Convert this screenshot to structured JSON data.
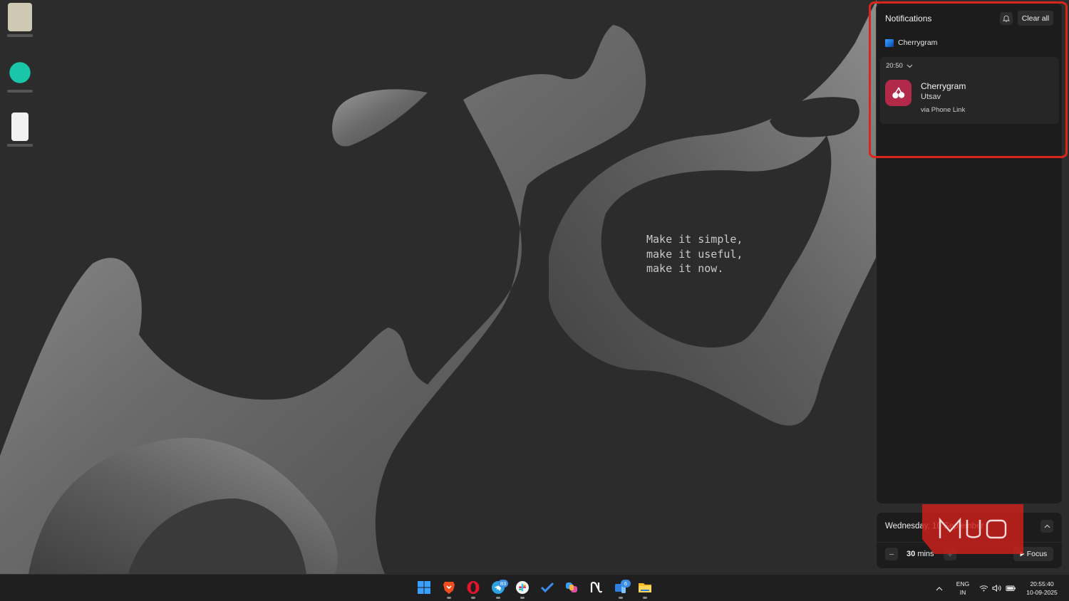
{
  "wallpaper": {
    "quote_lines": [
      "Make it simple,",
      "make it useful,",
      "make it now."
    ]
  },
  "notifications": {
    "title": "Notifications",
    "dnd_icon": "do-not-disturb-icon",
    "clear_all_label": "Clear all",
    "app_group": "Cherrygram",
    "item": {
      "time": "20:50",
      "app": "Cherrygram",
      "sender": "Utsav",
      "source": "via Phone Link"
    }
  },
  "calendar": {
    "date": "Wednesday, 10 September",
    "focus_value": "30",
    "focus_unit": "mins",
    "focus_label": "Focus"
  },
  "taskbar": {
    "apps": [
      {
        "name": "start",
        "icon": "windows-icon"
      },
      {
        "name": "brave",
        "icon": "brave-icon"
      },
      {
        "name": "opera",
        "icon": "opera-icon"
      },
      {
        "name": "telegram",
        "icon": "telegram-icon",
        "badge": "83"
      },
      {
        "name": "slack",
        "icon": "slack-icon"
      },
      {
        "name": "todo",
        "icon": "todo-icon"
      },
      {
        "name": "copilot",
        "icon": "copilot-icon"
      },
      {
        "name": "notion",
        "icon": "notion-icon"
      },
      {
        "name": "phone-link",
        "icon": "phone-link-icon",
        "badge": "6"
      },
      {
        "name": "file-explorer",
        "icon": "folder-icon"
      }
    ],
    "tray": {
      "lang_top": "ENG",
      "lang_bottom": "IN",
      "time": "20:55:40",
      "date": "10-09-2025"
    }
  },
  "watermark_text": "MUO",
  "colors": {
    "highlight": "#d9261c",
    "panel": "#1c1c1c",
    "cherry": "#b3294a",
    "accent": "#3a8ee6"
  }
}
